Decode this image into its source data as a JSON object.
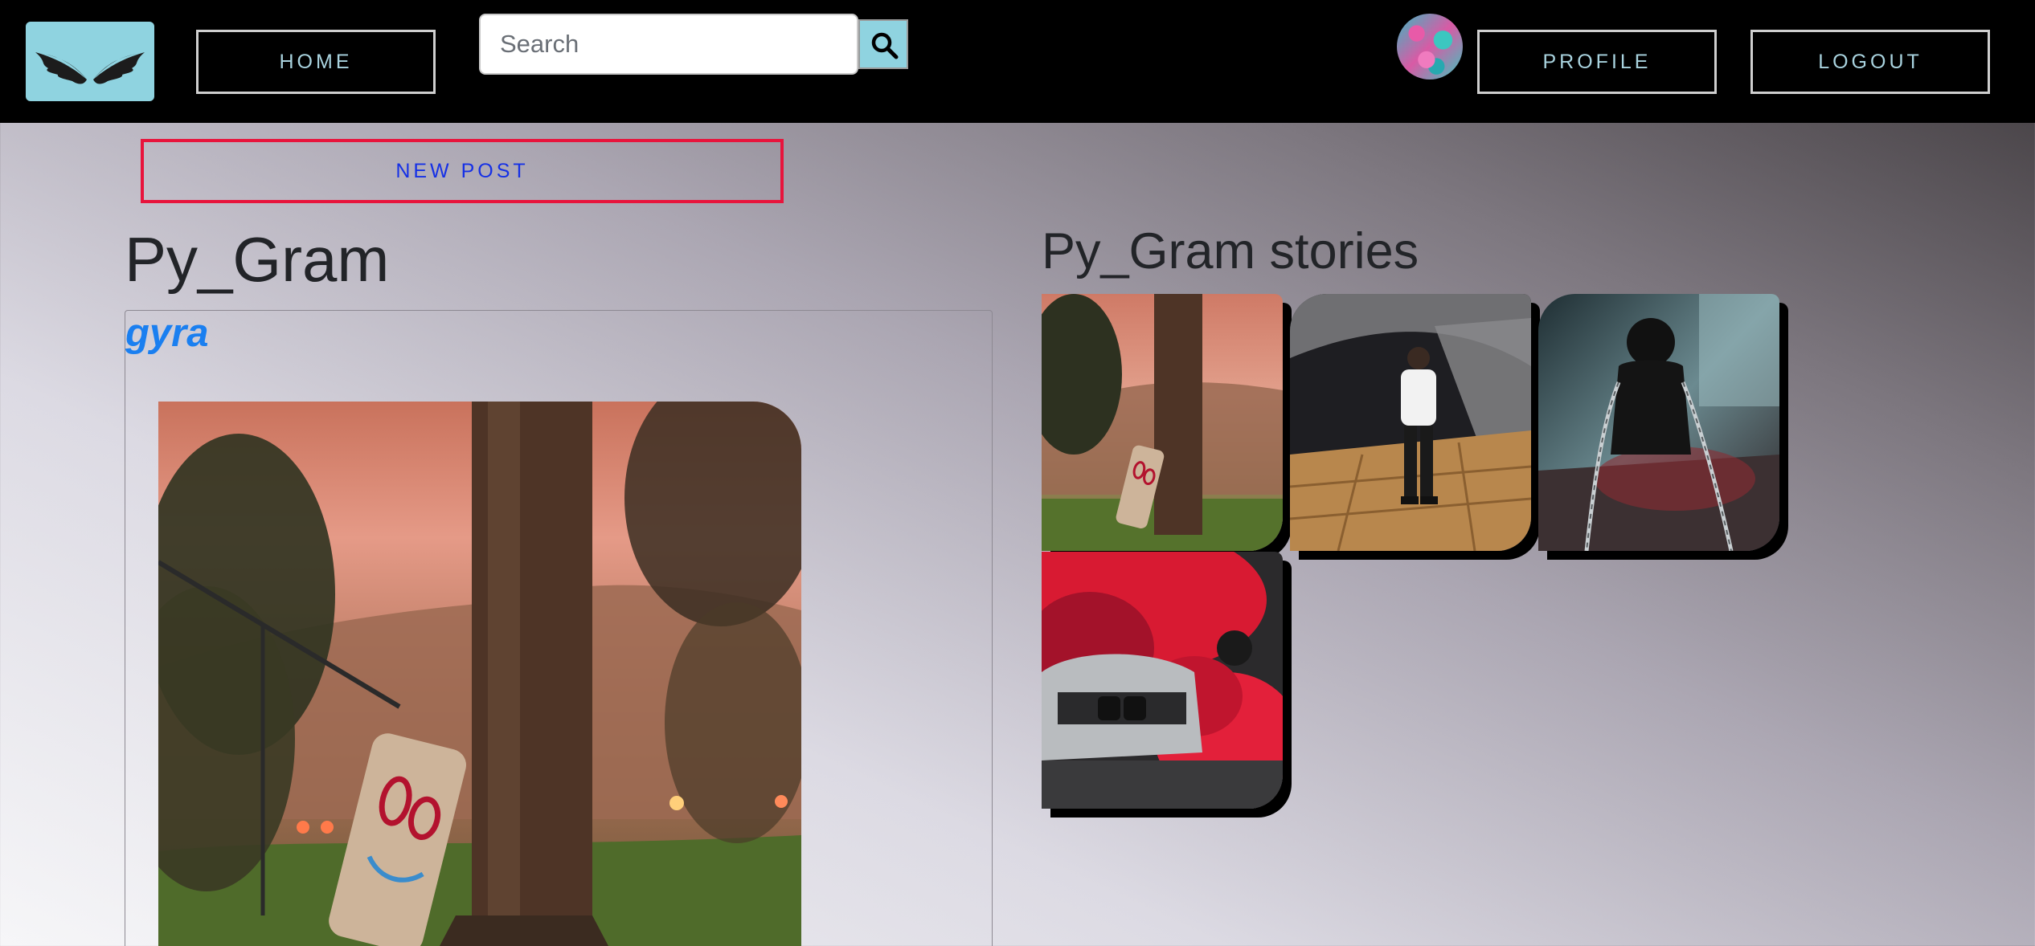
{
  "navbar": {
    "logo_icon": "wings-logo-icon",
    "home_label": "HOME",
    "search_placeholder": "Search",
    "search_value": "",
    "search_icon": "search-icon",
    "profile_label": "PROFILE",
    "logout_label": "LOGOUT"
  },
  "actions": {
    "new_post_label": "NEW POST"
  },
  "feed": {
    "title": "Py_Gram",
    "post": {
      "username": "gyra"
    }
  },
  "stories": {
    "title": "Py_Gram stories",
    "count": 4
  },
  "colors": {
    "navbar_bg": "#000000",
    "accent_cyan": "#8fd3e0",
    "nav_text": "#a9d3df",
    "new_post_border": "#e8143c",
    "new_post_text": "#1530e6",
    "username_link": "#1a7ff0"
  }
}
